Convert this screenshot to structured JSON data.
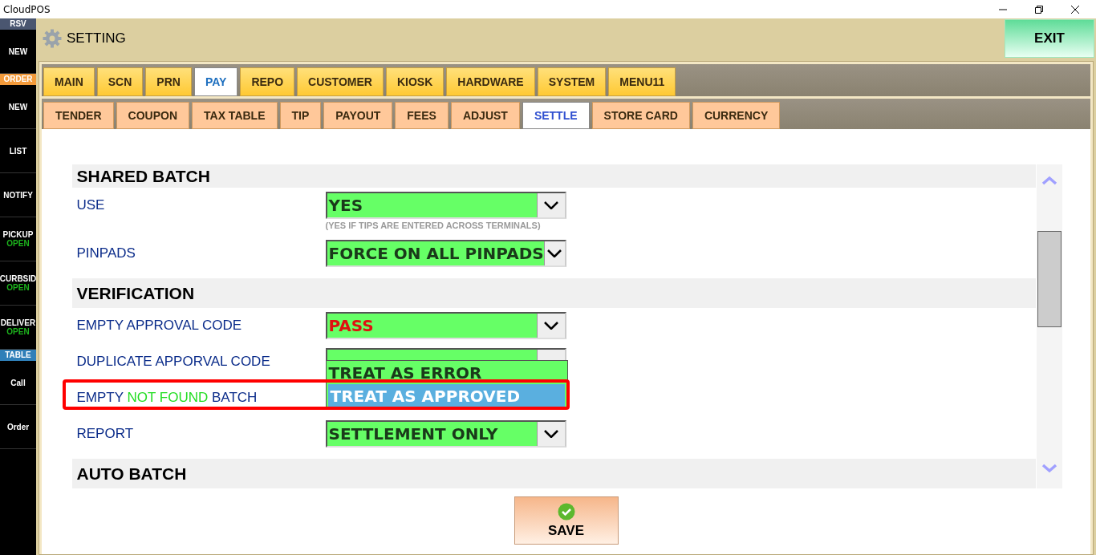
{
  "window": {
    "title": "CloudPOS"
  },
  "sidebar": [
    {
      "kind": "header",
      "label": "RSV",
      "color": "#4a5670"
    },
    {
      "kind": "item",
      "label": "NEW"
    },
    {
      "kind": "header",
      "label": "ORDER",
      "color": "#f39a3a"
    },
    {
      "kind": "item",
      "label": "NEW"
    },
    {
      "kind": "item",
      "label": "LIST"
    },
    {
      "kind": "item",
      "label": "NOTIFY"
    },
    {
      "kind": "item",
      "label": "PICKUP",
      "status": "OPEN"
    },
    {
      "kind": "item",
      "label": "CURBSID",
      "status": "OPEN"
    },
    {
      "kind": "item",
      "label": "DELIVER",
      "status": "OPEN"
    },
    {
      "kind": "header",
      "label": "TABLE",
      "color": "#2f7fb8"
    },
    {
      "kind": "item",
      "label": "Call"
    },
    {
      "kind": "item",
      "label": "Order"
    }
  ],
  "header": {
    "title": "SETTING",
    "exit": "EXIT"
  },
  "tabs": [
    {
      "label": "MAIN",
      "selected": false
    },
    {
      "label": "SCN",
      "selected": false
    },
    {
      "label": "PRN",
      "selected": false
    },
    {
      "label": "PAY",
      "selected": true
    },
    {
      "label": "REPO",
      "selected": false
    },
    {
      "label": "CUSTOMER",
      "selected": false
    },
    {
      "label": "KIOSK",
      "selected": false
    },
    {
      "label": "HARDWARE",
      "selected": false
    },
    {
      "label": "SYSTEM",
      "selected": false
    },
    {
      "label": "MENU11",
      "selected": false
    }
  ],
  "subtabs": [
    {
      "label": "TENDER",
      "selected": false
    },
    {
      "label": "COUPON",
      "selected": false
    },
    {
      "label": "TAX TABLE",
      "selected": false
    },
    {
      "label": "TIP",
      "selected": false
    },
    {
      "label": "PAYOUT",
      "selected": false
    },
    {
      "label": "FEES",
      "selected": false
    },
    {
      "label": "ADJUST",
      "selected": false
    },
    {
      "label": "SETTLE",
      "selected": true
    },
    {
      "label": "STORE CARD",
      "selected": false
    },
    {
      "label": "CURRENCY",
      "selected": false
    }
  ],
  "sections": [
    {
      "title": "SHARED BATCH",
      "rows": [
        {
          "label": [
            {
              "text": "USE",
              "highlight": false
            }
          ],
          "value": "YES",
          "alert": false,
          "hint": "(YES IF TIPS ARE ENTERED ACROSS TERMINALS)"
        },
        {
          "label": [
            {
              "text": "PINPADS",
              "highlight": false
            }
          ],
          "value": "FORCE ON ALL PINPADS",
          "alert": false
        }
      ]
    },
    {
      "title": "VERIFICATION",
      "rows": [
        {
          "label": [
            {
              "text": "EMPTY APPROVAL CODE",
              "highlight": false
            }
          ],
          "value": "PASS",
          "alert": true
        },
        {
          "label": [
            {
              "text": "DUPLICATE APPORVAL CODE",
              "highlight": false
            }
          ]
        },
        {
          "label": [
            {
              "text": "EMPTY",
              "highlight": false
            },
            {
              "text": "NOT FOUND",
              "highlight": true
            },
            {
              "text": "BATCH",
              "highlight": false
            }
          ],
          "marked": true,
          "options": [
            {
              "label": "TREAT AS ERROR",
              "selected": false
            },
            {
              "label": "TREAT AS APPROVED",
              "selected": true
            }
          ]
        },
        {
          "label": [
            {
              "text": "REPORT",
              "highlight": false
            }
          ],
          "value": "SETTLEMENT ONLY",
          "alert": false
        }
      ]
    },
    {
      "title": "AUTO BATCH"
    }
  ],
  "save": "SAVE"
}
